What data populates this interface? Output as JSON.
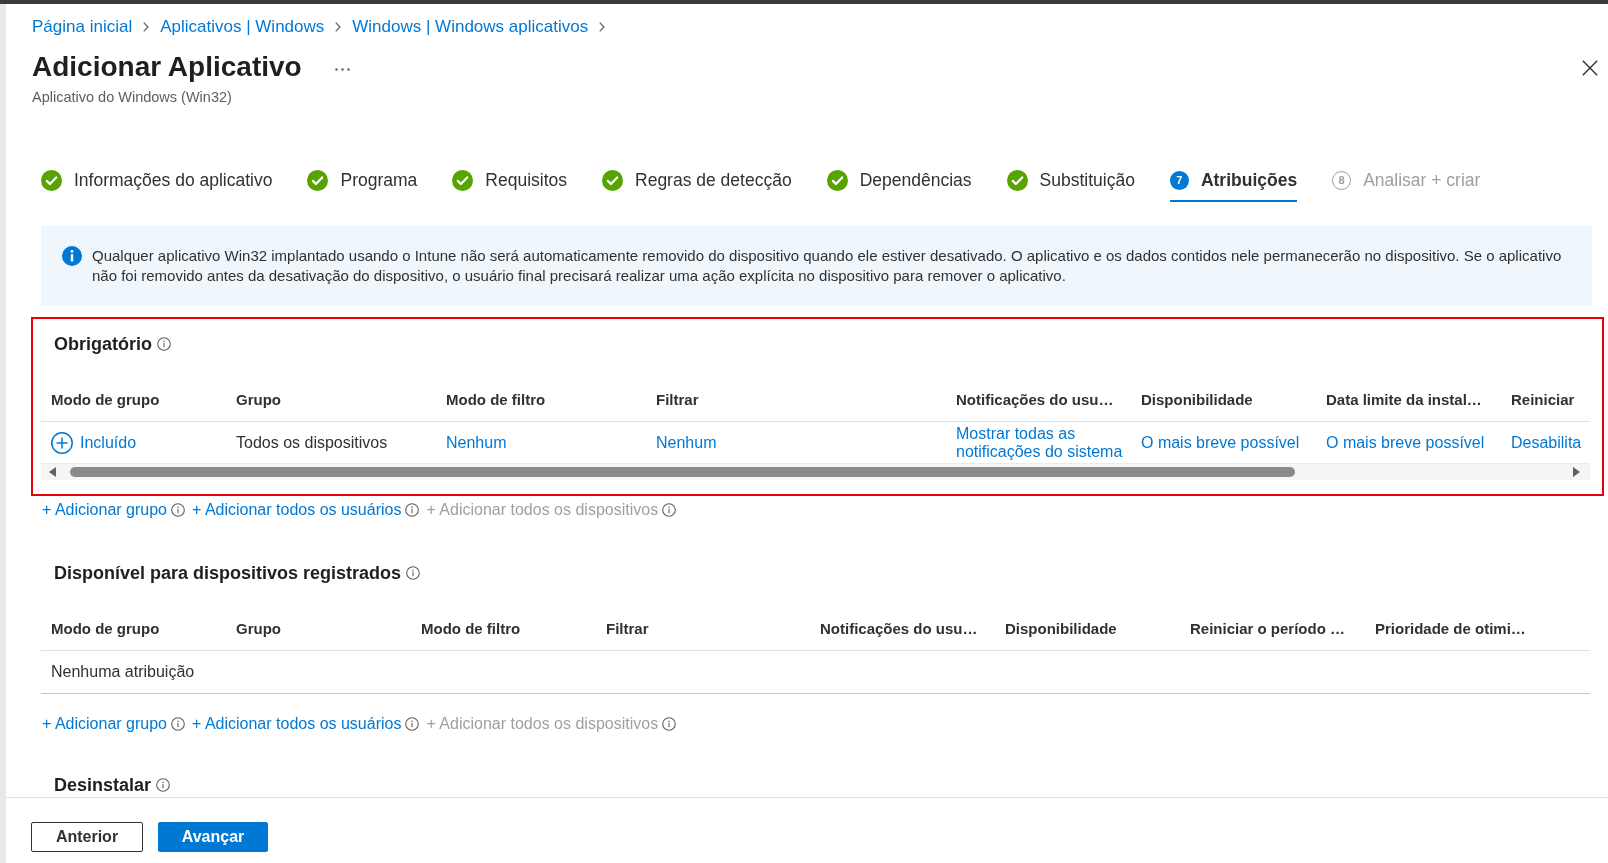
{
  "breadcrumb": [
    "Página inicial",
    "Aplicativos | Windows",
    "Windows | Windows aplicativos"
  ],
  "title": "Adicionar Aplicativo",
  "subtitle": "Aplicativo do Windows (Win32)",
  "tabs": [
    {
      "label": "Informações do aplicativo",
      "kind": "done",
      "selected": false,
      "disabled": false
    },
    {
      "label": "Programa",
      "kind": "done",
      "selected": false,
      "disabled": false
    },
    {
      "label": "Requisitos",
      "kind": "done",
      "selected": false,
      "disabled": false
    },
    {
      "label": "Regras de detecção",
      "kind": "done",
      "selected": false,
      "disabled": false
    },
    {
      "label": "Dependências",
      "kind": "done",
      "selected": false,
      "disabled": false
    },
    {
      "label": "Substituição",
      "kind": "done",
      "selected": false,
      "disabled": false
    },
    {
      "label": "Atribuições",
      "kind": "numbered",
      "number": "7",
      "selected": true,
      "disabled": false
    },
    {
      "label": "Analisar + criar",
      "kind": "numbered",
      "number": "8",
      "selected": false,
      "disabled": true
    }
  ],
  "info_banner": {
    "text": "Qualquer aplicativo Win32 implantado usando o Intune não será automaticamente removido do dispositivo quando ele estiver desativado. O aplicativo e os dados contidos nele permanecerão no dispositivo. Se o aplicativo não foi removido antes da desativação do dispositivo, o usuário final precisará realizar uma ação explícita no dispositivo para remover o aplicativo."
  },
  "sections": [
    {
      "title": "Obrigatório",
      "highlighted": true,
      "horizontal_scroll": true,
      "columns": [
        "Modo de grupo",
        "Grupo",
        "Modo de filtro",
        "Filtrar",
        "Notificações do usu…",
        "Disponibilidade",
        "Data limite da instal…",
        "Reiniciar"
      ],
      "rows": [
        {
          "cells": [
            {
              "kind": "mode",
              "text": "Incluído"
            },
            {
              "kind": "text",
              "text": "Todos os dispositivos"
            },
            {
              "kind": "link",
              "text": "Nenhum"
            },
            {
              "kind": "link",
              "text": "Nenhum"
            },
            {
              "kind": "link",
              "text": "Mostrar todas as notificações do sistema"
            },
            {
              "kind": "link",
              "text": "O mais breve possível"
            },
            {
              "kind": "link",
              "text": "O mais breve possível"
            },
            {
              "kind": "link",
              "text": "Desabilita"
            }
          ]
        }
      ],
      "add_links": [
        {
          "label": "+ Adicionar grupo",
          "disabled": false
        },
        {
          "label": "+ Adicionar todos os usuários",
          "disabled": false
        },
        {
          "label": "+ Adicionar todos os dispositivos",
          "disabled": true
        }
      ]
    },
    {
      "title": "Disponível para dispositivos registrados",
      "highlighted": false,
      "horizontal_scroll": false,
      "columns": [
        "Modo de grupo",
        "Grupo",
        "Modo de filtro",
        "Filtrar",
        "Notificações do usu…",
        "Disponibilidade",
        "Reiniciar o período …",
        "Prioridade de otimi…"
      ],
      "empty_message": "Nenhuma atribuição",
      "add_links": [
        {
          "label": "+ Adicionar grupo",
          "disabled": false
        },
        {
          "label": "+ Adicionar todos os usuários",
          "disabled": false
        },
        {
          "label": "+ Adicionar todos os dispositivos",
          "disabled": true
        }
      ]
    },
    {
      "title": "Desinstalar",
      "highlighted": false
    }
  ],
  "footer_buttons": [
    {
      "label": "Anterior",
      "kind": "secondary"
    },
    {
      "label": "Avançar",
      "kind": "primary"
    }
  ]
}
